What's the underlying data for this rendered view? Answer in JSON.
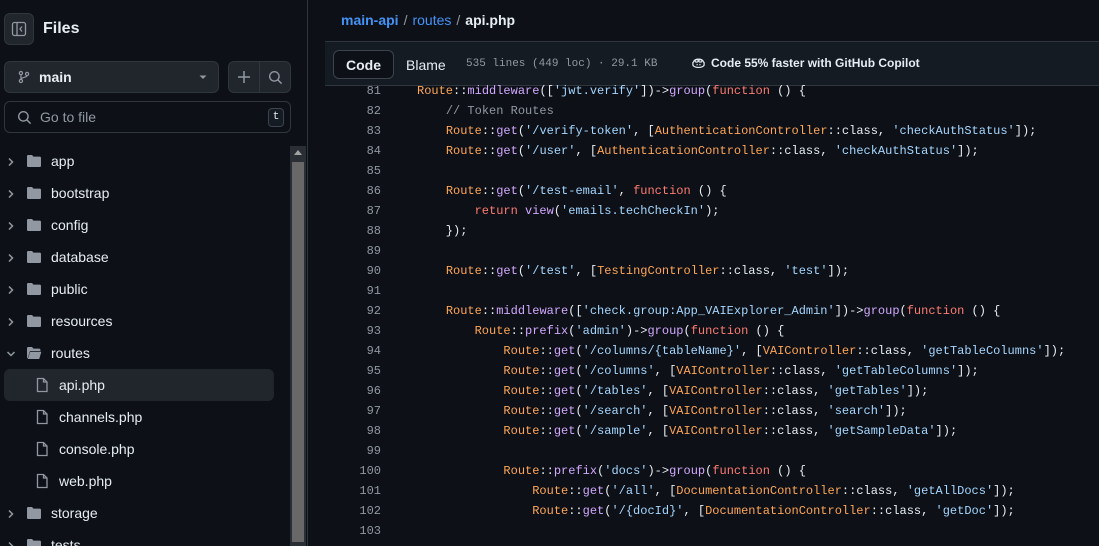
{
  "sidebar": {
    "title": "Files",
    "branch": "main",
    "goto_placeholder": "Go to file",
    "goto_shortcut": "t",
    "tree": [
      {
        "type": "dir",
        "name": "app",
        "expanded": false,
        "depth": 0
      },
      {
        "type": "dir",
        "name": "bootstrap",
        "expanded": false,
        "depth": 0
      },
      {
        "type": "dir",
        "name": "config",
        "expanded": false,
        "depth": 0
      },
      {
        "type": "dir",
        "name": "database",
        "expanded": false,
        "depth": 0
      },
      {
        "type": "dir",
        "name": "public",
        "expanded": false,
        "depth": 0
      },
      {
        "type": "dir",
        "name": "resources",
        "expanded": false,
        "depth": 0
      },
      {
        "type": "dir",
        "name": "routes",
        "expanded": true,
        "depth": 0
      },
      {
        "type": "file",
        "name": "api.php",
        "depth": 1,
        "selected": true
      },
      {
        "type": "file",
        "name": "channels.php",
        "depth": 1
      },
      {
        "type": "file",
        "name": "console.php",
        "depth": 1
      },
      {
        "type": "file",
        "name": "web.php",
        "depth": 1
      },
      {
        "type": "dir",
        "name": "storage",
        "expanded": false,
        "depth": 0
      },
      {
        "type": "dir",
        "name": "tests",
        "expanded": false,
        "depth": 0
      }
    ]
  },
  "breadcrumb": {
    "repo": "main-api",
    "sep1": "/",
    "folder": "routes",
    "sep2": "/",
    "file": "api.php"
  },
  "file_header": {
    "tab_code": "Code",
    "tab_blame": "Blame",
    "meta": "535 lines (449 loc) · 29.1 KB",
    "copilot": "Code 55% faster with GitHub Copilot"
  },
  "code_lines": [
    {
      "n": "81",
      "t": "Route::middleware(['jwt.verify'])->group(function () {"
    },
    {
      "n": "82",
      "t": "    // Token Routes"
    },
    {
      "n": "83",
      "t": "    Route::get('/verify-token', [AuthenticationController::class, 'checkAuthStatus']);"
    },
    {
      "n": "84",
      "t": "    Route::get('/user', [AuthenticationController::class, 'checkAuthStatus']);"
    },
    {
      "n": "85",
      "t": ""
    },
    {
      "n": "86",
      "t": "    Route::get('/test-email', function () {"
    },
    {
      "n": "87",
      "t": "        return view('emails.techCheckIn');"
    },
    {
      "n": "88",
      "t": "    });"
    },
    {
      "n": "89",
      "t": ""
    },
    {
      "n": "90",
      "t": "    Route::get('/test', [TestingController::class, 'test']);"
    },
    {
      "n": "91",
      "t": ""
    },
    {
      "n": "92",
      "t": "    Route::middleware(['check.group:App_VAIExplorer_Admin'])->group(function () {"
    },
    {
      "n": "93",
      "t": "        Route::prefix('admin')->group(function () {"
    },
    {
      "n": "94",
      "t": "            Route::get('/columns/{tableName}', [VAIController::class, 'getTableColumns']);"
    },
    {
      "n": "95",
      "t": "            Route::get('/columns', [VAIController::class, 'getTableColumns']);"
    },
    {
      "n": "96",
      "t": "            Route::get('/tables', [VAIController::class, 'getTables']);"
    },
    {
      "n": "97",
      "t": "            Route::get('/search', [VAIController::class, 'search']);"
    },
    {
      "n": "98",
      "t": "            Route::get('/sample', [VAIController::class, 'getSampleData']);"
    },
    {
      "n": "99",
      "t": ""
    },
    {
      "n": "100",
      "t": "            Route::prefix('docs')->group(function () {"
    },
    {
      "n": "101",
      "t": "                Route::get('/all', [DocumentationController::class, 'getAllDocs']);"
    },
    {
      "n": "102",
      "t": "                Route::get('/{docId}', [DocumentationController::class, 'getDoc']);"
    },
    {
      "n": "103",
      "t": ""
    }
  ],
  "colors": {
    "bg": "#0d1117",
    "link": "#4493f8",
    "class": "#ffa657",
    "keyword": "#ff7b72",
    "function": "#d2a8ff",
    "string": "#a5d6ff"
  }
}
